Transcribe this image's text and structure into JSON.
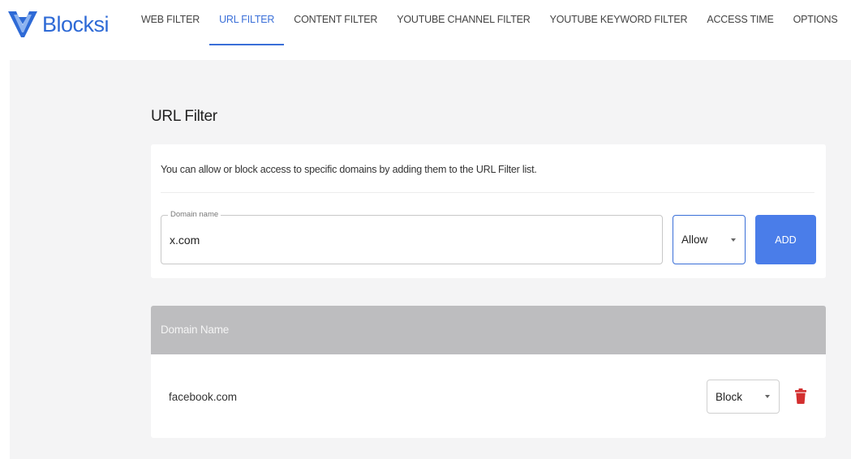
{
  "brand": {
    "name": "Blocksi",
    "color": "#2e6ad6",
    "icon": "blocksi-v-logo-icon"
  },
  "nav": {
    "items": [
      {
        "label": "WEB FILTER",
        "active": false
      },
      {
        "label": "URL FILTER",
        "active": true
      },
      {
        "label": "CONTENT FILTER",
        "active": false
      },
      {
        "label": "YOUTUBE CHANNEL FILTER",
        "active": false
      },
      {
        "label": "YOUTUBE KEYWORD FILTER",
        "active": false
      },
      {
        "label": "ACCESS TIME",
        "active": false
      },
      {
        "label": "OPTIONS",
        "active": false
      }
    ],
    "active_color": "#3a6fd8"
  },
  "page": {
    "title": "URL Filter"
  },
  "add_form": {
    "description": "You can allow or block access to specific domains by adding them to the URL Filter list.",
    "domain_label": "Domain name",
    "domain_value": "x.com",
    "action_selected": "Allow",
    "add_label": "ADD",
    "add_color": "#4a7de9"
  },
  "table": {
    "header": "Domain Name",
    "rows": [
      {
        "domain": "facebook.com",
        "action": "Block",
        "delete_icon": "trash-icon",
        "delete_color": "#d32f2f"
      }
    ]
  }
}
